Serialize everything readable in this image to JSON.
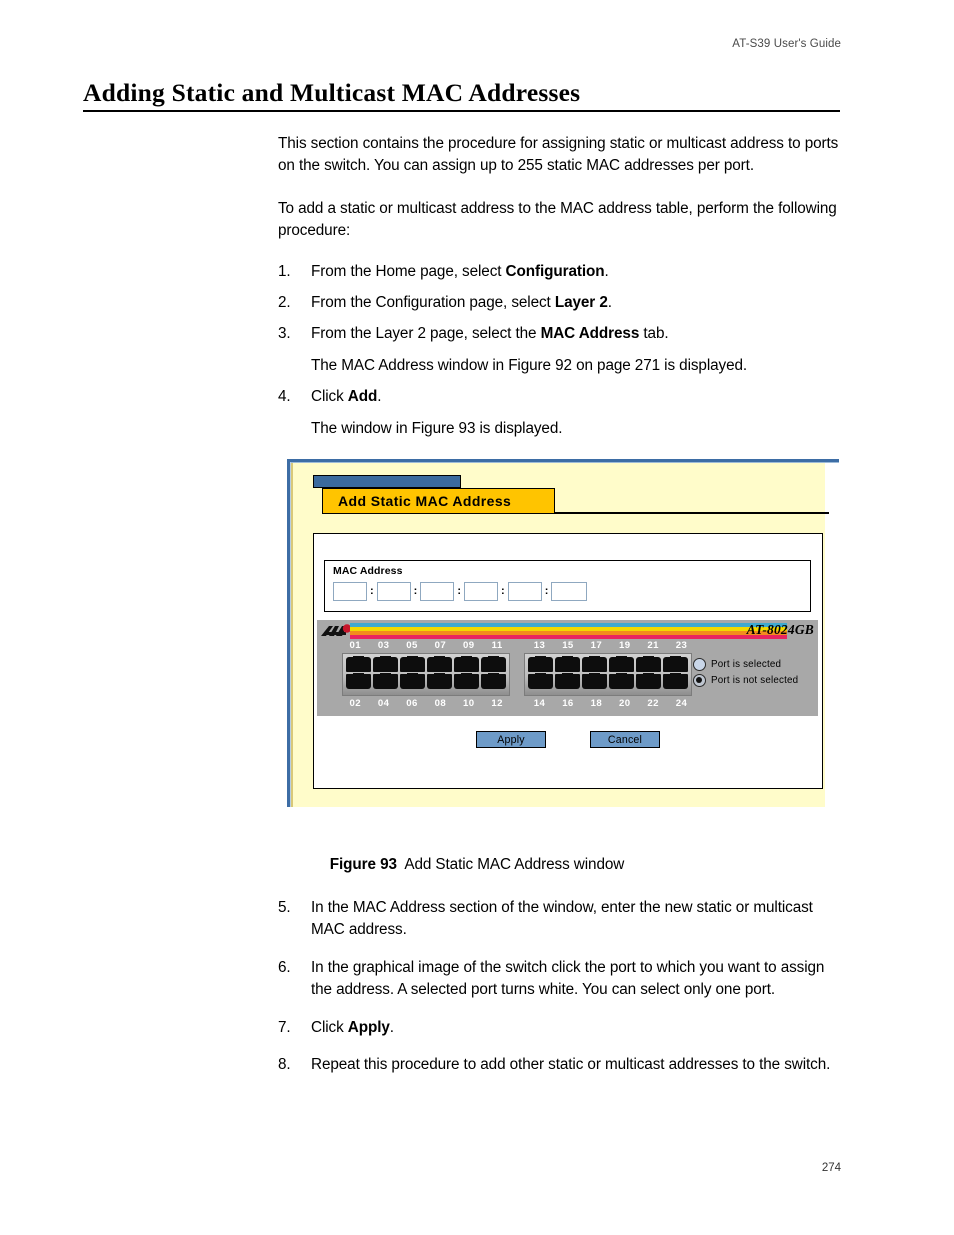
{
  "header": {
    "running_head": "AT-S39 User's Guide",
    "page_number": "274"
  },
  "page_title": "Adding Static and Multicast MAC Addresses",
  "intro": {
    "p1": "This section contains the procedure for assigning static or multicast address to ports on the switch. You can assign up to 255 static MAC addresses per port.",
    "p2": "To add a static or multicast address to the MAC address table, perform the following procedure:"
  },
  "steps_upper": [
    {
      "num": "1.",
      "pre": "From the Home page, select ",
      "bold": "Configuration",
      "post": "."
    },
    {
      "num": "2.",
      "pre": "From the Configuration page, select ",
      "bold": "Layer 2",
      "post": "."
    },
    {
      "num": "3.",
      "pre": "From the Layer 2 page, select the ",
      "bold": "MAC Address",
      "post": " tab."
    },
    {
      "num": "4.",
      "pre": "Click ",
      "bold": "Add",
      "post": "."
    }
  ],
  "step3_note": "The MAC Address window in Figure 92 on page 271 is displayed.",
  "step4_note": "The window in Figure 93 is displayed.",
  "figure": {
    "title_strip_label": "",
    "tab_label": "Add Static MAC Address",
    "mac_group": {
      "legend": "MAC Address",
      "octets": [
        "",
        "",
        "",
        "",
        "",
        ""
      ],
      "separator": ":",
      "placeholder": ""
    },
    "switch": {
      "model": "AT-8024GB",
      "brand_logo": "allied-telesyn-logo",
      "stripe_colors": [
        "#3fa9cf",
        "#f2d900",
        "#f28c1c",
        "#e8255f"
      ],
      "chassis_color": "#a8a8a8",
      "ports_top_left": [
        "01",
        "03",
        "05",
        "07",
        "09",
        "11"
      ],
      "ports_top_right": [
        "13",
        "15",
        "17",
        "19",
        "21",
        "23"
      ],
      "ports_bottom_left": [
        "02",
        "04",
        "06",
        "08",
        "10",
        "12"
      ],
      "ports_bottom_right": [
        "14",
        "16",
        "18",
        "20",
        "22",
        "24"
      ],
      "legend": [
        {
          "label": "Port is selected",
          "selected": false
        },
        {
          "label": "Port is not selected",
          "selected": true
        }
      ]
    },
    "buttons": {
      "apply": "Apply",
      "cancel": "Cancel"
    },
    "colors": {
      "window_background": "#fffcca",
      "tab_background": "#ffc400",
      "title_strip": "#3b6a9e",
      "frame": "#3d6da5",
      "button": "#6e9bc8"
    }
  },
  "caption": {
    "label": "Figure 93",
    "text": "Add Static MAC Address window"
  },
  "steps_lower": [
    {
      "num": "5.",
      "pre": "In the MAC Address section of the window, enter the new static or multicast MAC address.",
      "bold": "",
      "post": ""
    },
    {
      "num": "6.",
      "pre": "In the graphical image of the switch click the port to which you want to assign the address. A selected port turns white. You can select only one port.",
      "bold": "",
      "post": ""
    },
    {
      "num": "7.",
      "pre": "Click ",
      "bold": "Apply",
      "post": "."
    },
    {
      "num": "8.",
      "pre": "Repeat this procedure to add other static or multicast addresses to the switch.",
      "bold": "",
      "post": ""
    }
  ]
}
